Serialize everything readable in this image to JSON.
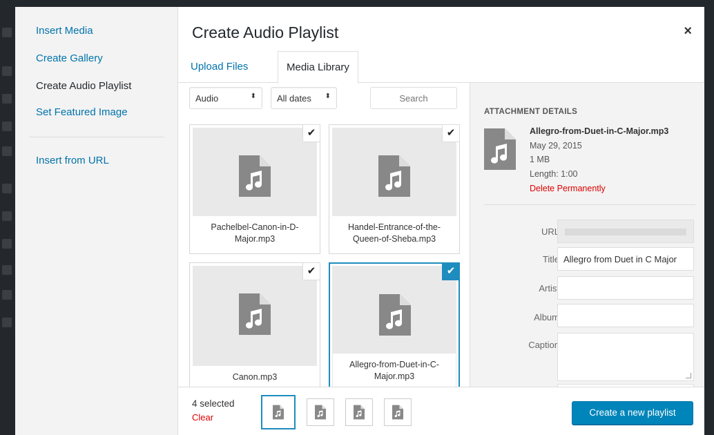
{
  "menu": {
    "items": [
      {
        "label": "Insert Media",
        "active": false
      },
      {
        "label": "Create Gallery",
        "active": false
      },
      {
        "label": "Create Audio Playlist",
        "active": true
      },
      {
        "label": "Set Featured Image",
        "active": false
      }
    ],
    "insert_from_url": "Insert from URL"
  },
  "header": {
    "title": "Create Audio Playlist",
    "close_glyph": "×"
  },
  "tabs": [
    {
      "label": "Upload Files",
      "active": false
    },
    {
      "label": "Media Library",
      "active": true
    }
  ],
  "filters": {
    "type_value": "Audio",
    "date_value": "All dates",
    "search_placeholder": "Search",
    "arrow_glyph": "⬍"
  },
  "attachments": [
    {
      "filename": "Pachelbel-Canon-in-D-Major.mp3",
      "selected": true
    },
    {
      "filename": "Handel-Entrance-of-the-Queen-of-Sheba.mp3",
      "selected": true
    },
    {
      "filename": "Canon.mp3",
      "selected": true
    },
    {
      "filename": "Allegro-from-Duet-in-C-Major.mp3",
      "selected": true,
      "current": true
    }
  ],
  "check_glyph": "✔",
  "details": {
    "heading": "ATTACHMENT DETAILS",
    "filename": "Allegro-from-Duet-in-C-Major.mp3",
    "date": "May 29, 2015",
    "size": "1 MB",
    "length": "Length: 1:00",
    "delete_label": "Delete Permanently",
    "fields": {
      "url_label": "URL",
      "url_value": "",
      "title_label": "Title",
      "title_value": "Allegro from Duet in C Major",
      "artist_label": "Artist",
      "artist_value": "",
      "album_label": "Album",
      "album_value": "",
      "caption_label": "Caption",
      "caption_value": ""
    }
  },
  "footer": {
    "selected_count": "4 selected",
    "clear_label": "Clear",
    "primary_button": "Create a new playlist"
  },
  "colors": {
    "accent": "#0073aa",
    "selection": "#1e8cbe",
    "danger": "#dd0000",
    "icon_gray": "#888888"
  },
  "icons": {
    "audio_file": "audio-file-icon",
    "check": "checkmark-icon",
    "close": "close-icon"
  }
}
